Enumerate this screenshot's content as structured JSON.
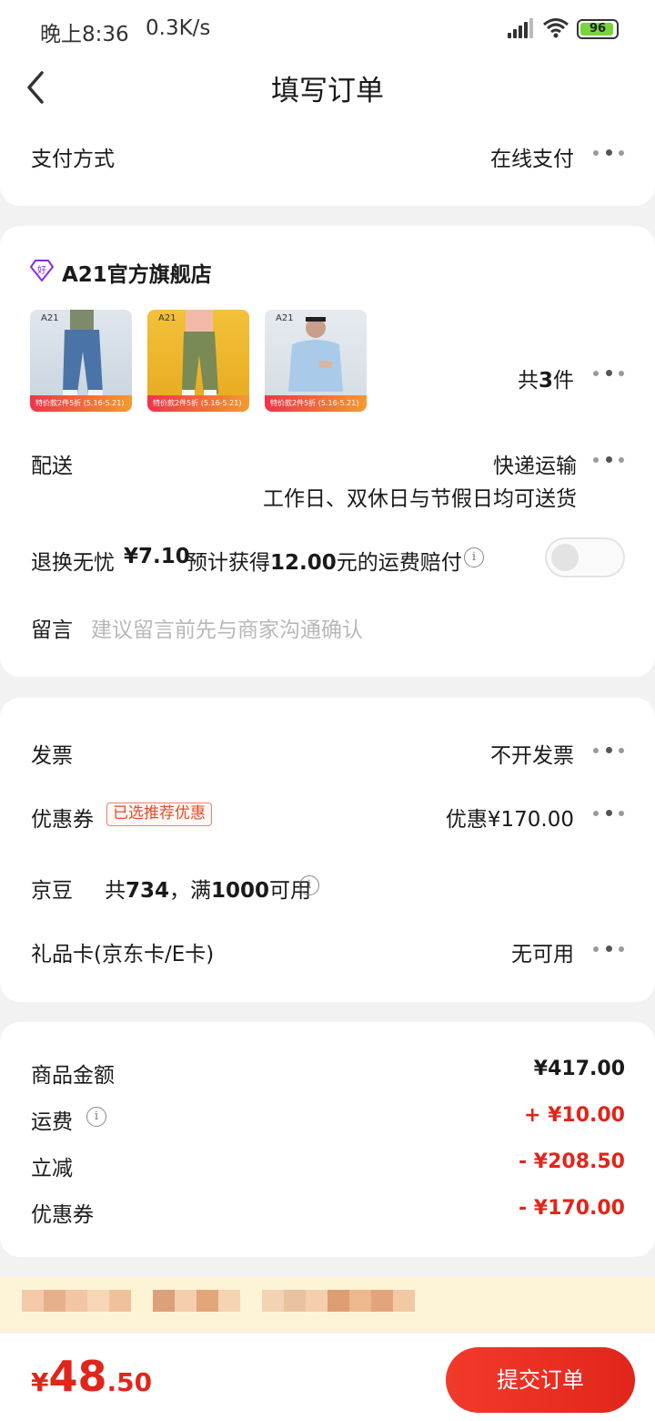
{
  "status_bar": {
    "time": "晚上8:36",
    "speed": "0.3K/s",
    "battery": "96",
    "battery_level": 0.96
  },
  "header": {
    "title": "填写订单"
  },
  "payment": {
    "label": "支付方式",
    "value": "在线支付"
  },
  "shop": {
    "name": "A21官方旗舰店",
    "products": [
      {
        "brand": "A21",
        "tag": "特价款2件5折 (5.16-5.21)"
      },
      {
        "brand": "A21",
        "tag": "特价款2件5折 (5.16-5.21)"
      },
      {
        "brand": "A21",
        "tag": "特价款2件5折 (5.16-5.21)"
      }
    ],
    "count_prefix": "共",
    "count_num": "3",
    "count_suffix": "件"
  },
  "delivery": {
    "label": "配送",
    "value": "快递运输",
    "note": "工作日、双休日与节假日均可送货"
  },
  "return_insurance": {
    "label": "退换无忧",
    "price": "¥7.10",
    "desc_prefix": "预计获得",
    "desc_amount": "12.00",
    "desc_suffix": "元的运费赔付",
    "enabled": false
  },
  "message": {
    "label": "留言",
    "placeholder": "建议留言前先与商家沟通确认"
  },
  "invoice": {
    "label": "发票",
    "value": "不开发票"
  },
  "coupon": {
    "label": "优惠券",
    "badge": "已选推荐优惠",
    "value": "优惠¥170.00"
  },
  "jingdou": {
    "label": "京豆",
    "prefix": "共",
    "amount": "734",
    "middle": "，满",
    "threshold": "1000",
    "suffix": "可用"
  },
  "giftcard": {
    "label": "礼品卡(京东卡/E卡)",
    "value": "无可用"
  },
  "summary": {
    "goods_label": "商品金额",
    "goods_value": "¥417.00",
    "shipping_label": "运费",
    "shipping_value": "+ ¥10.00",
    "discount_label": "立减",
    "discount_value": "- ¥208.50",
    "coupon_label": "优惠券",
    "coupon_value": "- ¥170.00"
  },
  "footer": {
    "currency": "¥",
    "total_int": "48",
    "total_dec": ".50",
    "submit": "提交订单"
  },
  "colors": {
    "accent": "#e1251b",
    "background": "#f2f2f2",
    "card": "#ffffff"
  }
}
